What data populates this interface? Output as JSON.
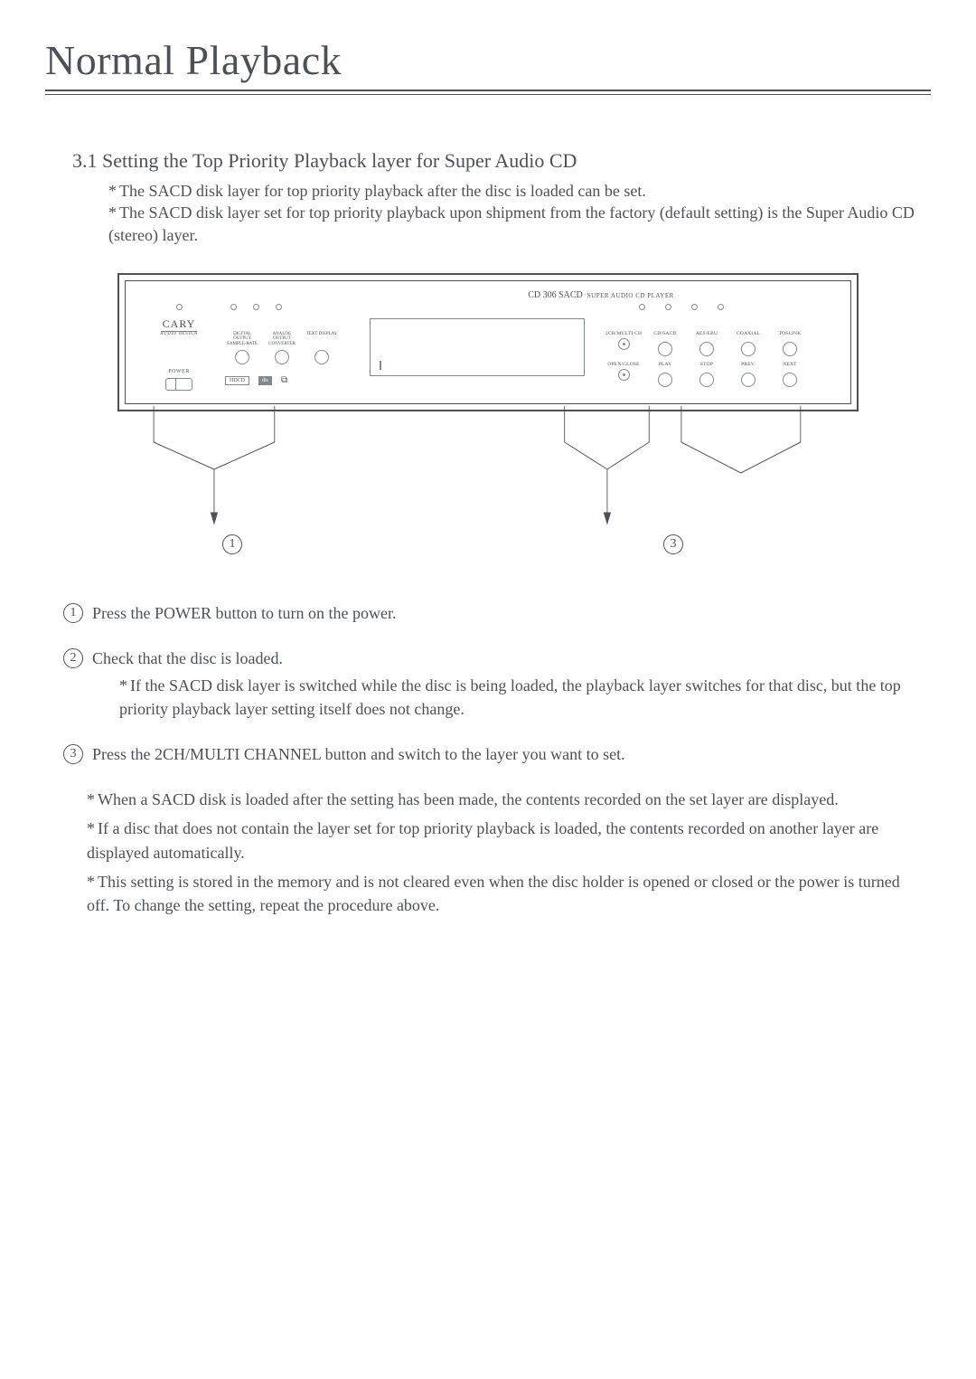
{
  "page_title": "Normal Playback",
  "section_heading": "3.1 Setting the Top Priority Playback layer for Super Audio CD",
  "intro_notes": [
    "The SACD disk layer for top priority playback after the disc is loaded can be set.",
    "The SACD disk layer set for top priority playback upon shipment from the factory (default setting) is the Super Audio CD (stereo) layer."
  ],
  "device": {
    "model_main": "CD 306 SACD",
    "model_sub": "SUPER AUDIO CD PLAYER",
    "logo": "CARY",
    "logo_sub": "AUDIO DESIGN",
    "mid_labels": [
      "DIGITAL OUTPUT SAMPLE-RATE",
      "ANALOG OUTPUT CONVERTER",
      "TEXT DISPLAY"
    ],
    "power_label": "POWER",
    "format_logo_1": "HDCD",
    "format_logo_2": "dts",
    "format_logo_3": "⧉",
    "right_row1": [
      "2CH/MULTI CH",
      "CD/SACD",
      "AES/EBU",
      "COAXIAL",
      "TOSLINK"
    ],
    "right_row2": [
      "OPEN/CLOSE",
      "PLAY",
      "STOP",
      "PREV.",
      "NEXT"
    ]
  },
  "callout_labels": {
    "one": "1",
    "three": "3"
  },
  "steps": [
    {
      "num": "1",
      "text": "Press the POWER button to turn on the power.",
      "sub": null
    },
    {
      "num": "2",
      "text": "Check that the disc is loaded.",
      "sub": "If the SACD disk layer is switched while the disc is being loaded, the playback layer switches for that disc, but the top priority playback layer setting itself does not change."
    },
    {
      "num": "3",
      "text": "Press the 2CH/MULTI CHANNEL button and switch to the layer you want to set.",
      "sub": null
    }
  ],
  "closing_notes": [
    "When a  SACD disk is loaded after the setting has been made, the contents recorded on the set  layer are displayed.",
    "If a disc that does not contain the layer set for top priority playback is loaded, the contents recorded on another layer are displayed automatically.",
    "This setting is stored in the memory and is not cleared even when the disc holder is opened or closed or the power is turned off. To change the setting, repeat the procedure above."
  ]
}
